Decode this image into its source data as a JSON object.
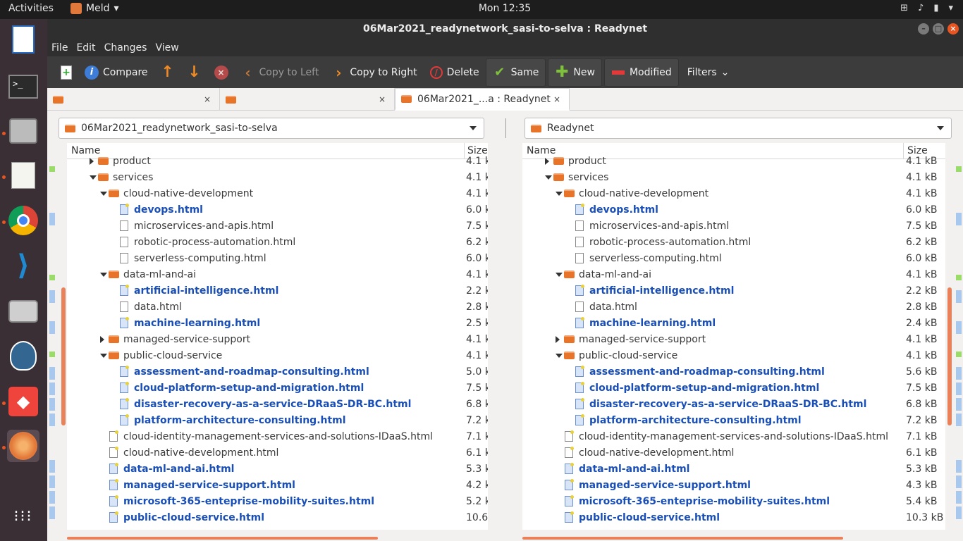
{
  "topbar": {
    "activities": "Activities",
    "app_name": "Meld",
    "clock": "Mon 12:35"
  },
  "window": {
    "title": "06Mar2021_readynetwork_sasi-to-selva : Readynet"
  },
  "menu": [
    "File",
    "Edit",
    "Changes",
    "View"
  ],
  "toolbar": {
    "compare": "Compare",
    "copy_left": "Copy to Left",
    "copy_right": "Copy to Right",
    "delete": "Delete",
    "same": "Same",
    "new": "New",
    "modified": "Modified",
    "filters": "Filters"
  },
  "tabs": [
    {
      "label": ""
    },
    {
      "label": ""
    },
    {
      "label": "06Mar2021_...a : Readynet"
    }
  ],
  "left_path": "06Mar2021_readynetwork_sasi-to-selva",
  "right_path": "Readynet",
  "columns": {
    "name": "Name",
    "size": "Size"
  },
  "left_rows": [
    {
      "name": "product",
      "size": "4.1 k",
      "kind": "folder",
      "level": 1,
      "twisty": "closed",
      "mod": false
    },
    {
      "name": "services",
      "size": "4.1 k",
      "kind": "folder",
      "level": 1,
      "twisty": "open",
      "mod": false
    },
    {
      "name": "cloud-native-development",
      "size": "4.1 k",
      "kind": "folder",
      "level": 2,
      "twisty": "open",
      "mod": false
    },
    {
      "name": "devops.html",
      "size": "6.0 k",
      "kind": "file",
      "level": 3,
      "mod": true
    },
    {
      "name": "microservices-and-apis.html",
      "size": "7.5 k",
      "kind": "file",
      "level": 3,
      "mod": false
    },
    {
      "name": "robotic-process-automation.html",
      "size": "6.2 k",
      "kind": "file",
      "level": 3,
      "mod": false
    },
    {
      "name": "serverless-computing.html",
      "size": "6.0 k",
      "kind": "file",
      "level": 3,
      "mod": false
    },
    {
      "name": "data-ml-and-ai",
      "size": "4.1 k",
      "kind": "folder",
      "level": 2,
      "twisty": "open",
      "mod": false
    },
    {
      "name": "artificial-intelligence.html",
      "size": "2.2 k",
      "kind": "file",
      "level": 3,
      "mod": true
    },
    {
      "name": "data.html",
      "size": "2.8 k",
      "kind": "file",
      "level": 3,
      "mod": false
    },
    {
      "name": "machine-learning.html",
      "size": "2.5 k",
      "kind": "file",
      "level": 3,
      "mod": true
    },
    {
      "name": "managed-service-support",
      "size": "4.1 k",
      "kind": "folder",
      "level": 2,
      "twisty": "closed",
      "mod": false
    },
    {
      "name": "public-cloud-service",
      "size": "4.1 k",
      "kind": "folder",
      "level": 2,
      "twisty": "open",
      "mod": false
    },
    {
      "name": "assessment-and-roadmap-consulting.html",
      "size": "5.0 k",
      "kind": "file",
      "level": 3,
      "mod": true
    },
    {
      "name": "cloud-platform-setup-and-migration.html",
      "size": "7.5 k",
      "kind": "file",
      "level": 3,
      "mod": true
    },
    {
      "name": "disaster-recovery-as-a-service-DRaaS-DR-BC.html",
      "size": "6.8 k",
      "kind": "file",
      "level": 3,
      "mod": true
    },
    {
      "name": "platform-architecture-consulting.html",
      "size": "7.2 k",
      "kind": "file",
      "level": 3,
      "mod": true
    },
    {
      "name": "cloud-identity-management-services-and-solutions-IDaaS.html",
      "size": "7.1 k",
      "kind": "file",
      "level": 2,
      "mod": false
    },
    {
      "name": "cloud-native-development.html",
      "size": "6.1 k",
      "kind": "file",
      "level": 2,
      "mod": false
    },
    {
      "name": "data-ml-and-ai.html",
      "size": "5.3 k",
      "kind": "file",
      "level": 2,
      "mod": true
    },
    {
      "name": "managed-service-support.html",
      "size": "4.2 k",
      "kind": "file",
      "level": 2,
      "mod": true
    },
    {
      "name": "microsoft-365-enteprise-mobility-suites.html",
      "size": "5.2 k",
      "kind": "file",
      "level": 2,
      "mod": true
    },
    {
      "name": "public-cloud-service.html",
      "size": "10.6",
      "kind": "file",
      "level": 2,
      "mod": true
    }
  ],
  "right_rows": [
    {
      "name": "product",
      "size": "4.1 kB",
      "kind": "folder",
      "level": 1,
      "twisty": "closed",
      "mod": false
    },
    {
      "name": "services",
      "size": "4.1 kB",
      "kind": "folder",
      "level": 1,
      "twisty": "open",
      "mod": false
    },
    {
      "name": "cloud-native-development",
      "size": "4.1 kB",
      "kind": "folder",
      "level": 2,
      "twisty": "open",
      "mod": false
    },
    {
      "name": "devops.html",
      "size": "6.0 kB",
      "kind": "file",
      "level": 3,
      "mod": true
    },
    {
      "name": "microservices-and-apis.html",
      "size": "7.5 kB",
      "kind": "file",
      "level": 3,
      "mod": false
    },
    {
      "name": "robotic-process-automation.html",
      "size": "6.2 kB",
      "kind": "file",
      "level": 3,
      "mod": false
    },
    {
      "name": "serverless-computing.html",
      "size": "6.0 kB",
      "kind": "file",
      "level": 3,
      "mod": false
    },
    {
      "name": "data-ml-and-ai",
      "size": "4.1 kB",
      "kind": "folder",
      "level": 2,
      "twisty": "open",
      "mod": false
    },
    {
      "name": "artificial-intelligence.html",
      "size": "2.2 kB",
      "kind": "file",
      "level": 3,
      "mod": true
    },
    {
      "name": "data.html",
      "size": "2.8 kB",
      "kind": "file",
      "level": 3,
      "mod": false
    },
    {
      "name": "machine-learning.html",
      "size": "2.4 kB",
      "kind": "file",
      "level": 3,
      "mod": true
    },
    {
      "name": "managed-service-support",
      "size": "4.1 kB",
      "kind": "folder",
      "level": 2,
      "twisty": "closed",
      "mod": false
    },
    {
      "name": "public-cloud-service",
      "size": "4.1 kB",
      "kind": "folder",
      "level": 2,
      "twisty": "open",
      "mod": false
    },
    {
      "name": "assessment-and-roadmap-consulting.html",
      "size": "5.6 kB",
      "kind": "file",
      "level": 3,
      "mod": true
    },
    {
      "name": "cloud-platform-setup-and-migration.html",
      "size": "7.5 kB",
      "kind": "file",
      "level": 3,
      "mod": true
    },
    {
      "name": "disaster-recovery-as-a-service-DRaaS-DR-BC.html",
      "size": "6.8 kB",
      "kind": "file",
      "level": 3,
      "mod": true
    },
    {
      "name": "platform-architecture-consulting.html",
      "size": "7.2 kB",
      "kind": "file",
      "level": 3,
      "mod": true
    },
    {
      "name": "cloud-identity-management-services-and-solutions-IDaaS.html",
      "size": "7.1 kB",
      "kind": "file",
      "level": 2,
      "mod": false
    },
    {
      "name": "cloud-native-development.html",
      "size": "6.1 kB",
      "kind": "file",
      "level": 2,
      "mod": false
    },
    {
      "name": "data-ml-and-ai.html",
      "size": "5.3 kB",
      "kind": "file",
      "level": 2,
      "mod": true
    },
    {
      "name": "managed-service-support.html",
      "size": "4.3 kB",
      "kind": "file",
      "level": 2,
      "mod": true
    },
    {
      "name": "microsoft-365-enteprise-mobility-suites.html",
      "size": "5.4 kB",
      "kind": "file",
      "level": 2,
      "mod": true
    },
    {
      "name": "public-cloud-service.html",
      "size": "10.3 kB",
      "kind": "file",
      "level": 2,
      "mod": true
    }
  ],
  "colors": {
    "accent": "#e95420",
    "modified_text": "#1a4fb8",
    "folder": "#e8742a"
  }
}
